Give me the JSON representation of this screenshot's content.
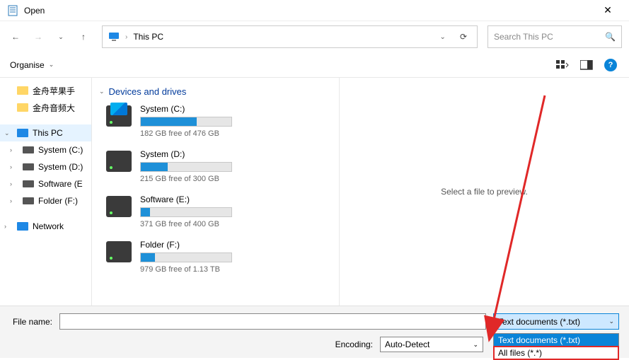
{
  "title": "Open",
  "address": {
    "location": "This PC"
  },
  "search": {
    "placeholder": "Search This PC"
  },
  "toolbar": {
    "organise": "Organise"
  },
  "sidebar": {
    "folders": [
      "金舟苹果手",
      "金舟音频大"
    ],
    "thispc": "This PC",
    "drives": [
      "System (C:)",
      "System (D:)",
      "Software (E",
      "Folder (F:)"
    ],
    "network": "Network"
  },
  "section": {
    "devices": "Devices and drives"
  },
  "drives": [
    {
      "name": "System (C:)",
      "free": "182 GB free of 476 GB",
      "pct": 62,
      "win": true
    },
    {
      "name": "System (D:)",
      "free": "215 GB free of 300 GB",
      "pct": 30,
      "win": false
    },
    {
      "name": "Software (E:)",
      "free": "371 GB free of 400 GB",
      "pct": 10,
      "win": false
    },
    {
      "name": "Folder (F:)",
      "free": "979 GB free of 1.13 TB",
      "pct": 16,
      "win": false
    }
  ],
  "preview": {
    "text": "Select a file to preview."
  },
  "footer": {
    "filename_label": "File name:",
    "filename_value": "",
    "filetype_selected": "Text documents (*.txt)",
    "encoding_label": "Encoding:",
    "encoding_value": "Auto-Detect",
    "options": [
      "Text documents (*.txt)",
      "All files  (*.*)"
    ]
  }
}
